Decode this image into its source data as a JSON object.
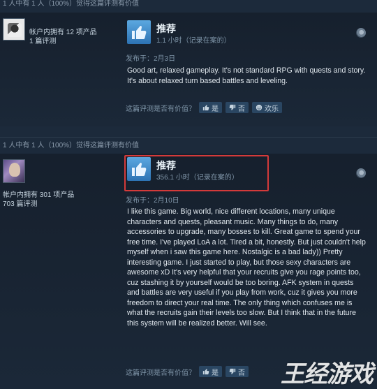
{
  "review1": {
    "helpful_summary": "1 人中有 1 人（100%）觉得这篇评测有价值",
    "author_stats_line1": "帐户内拥有 12 项产品",
    "author_stats_line2": "1 篇评测",
    "vote_title": "推荐",
    "hours": "1.1 小时（记录在案的）",
    "posted": "发布于：2月3日",
    "body": "Good art, relaxed gameplay. It's not standard RPG with quests and story. It's about relaxed turn based battles and leveling.",
    "helpful_question": "这篇评测是否有价值？",
    "yes_label": "是",
    "no_label": "否",
    "funny_label": "欢乐"
  },
  "review2": {
    "helpful_summary": "1 人中有 1 人（100%）觉得这篇评测有价值",
    "author_stats_line1": "帐户内拥有 301 项产品",
    "author_stats_line2": "703 篇评测",
    "vote_title": "推荐",
    "hours": "356.1 小时（记录在案的）",
    "posted": "发布于：2月10日",
    "body": "I like this game. Big world, nice different locations, many unique characters and quests, pleasant music. Many things to do, many accessories to upgrade, many bosses to kill. Great game to spend your free time. I've played LoA a lot. Tired a bit, honestly. But just couldn't help myself when i saw this game here. Nostalgic is a bad lady)) Pretty interesting game. I just started to play, but those sexy characters are awesome xD It's very helpful that your recruits give you rage points too, cuz stashing it by yourself would be too boring. AFK system in quests and battles are very useful if you play from work, cuz it gives you more freedom to direct your real time. The only thing which confuses me is what the recruits gain their levels too slow. But I think that in the future this system will be realized better. Will see.",
    "helpful_question": "这篇评测是否有价值？",
    "yes_label": "是",
    "no_label": "否"
  },
  "watermark": "王经游戏",
  "colors": {
    "background": "#1b2838",
    "thumb_gradient_top": "#5ba8e0",
    "thumb_gradient_bottom": "#2d73b4",
    "highlight_border": "#d43a3a"
  }
}
